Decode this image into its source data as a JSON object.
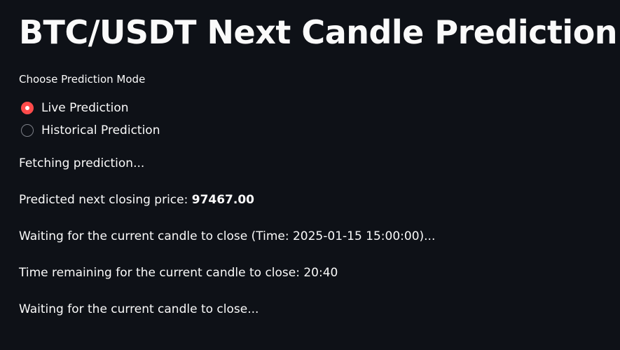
{
  "title": "BTC/USDT Next Candle Prediction",
  "mode": {
    "label": "Choose Prediction Mode",
    "options": [
      {
        "label": "Live Prediction",
        "selected": true
      },
      {
        "label": "Historical Prediction",
        "selected": false
      }
    ]
  },
  "messages": {
    "fetching": "Fetching prediction...",
    "predicted_prefix": "Predicted next closing price: ",
    "predicted_value": "97467.00",
    "waiting_time": "Waiting for the current candle to close (Time: 2025-01-15 15:00:00)...",
    "time_remaining": "Time remaining for the current candle to close: 20:40",
    "waiting": "Waiting for the current candle to close..."
  },
  "colors": {
    "background": "#0e1117",
    "accent": "#ff4b4b",
    "text": "#fafafa"
  }
}
